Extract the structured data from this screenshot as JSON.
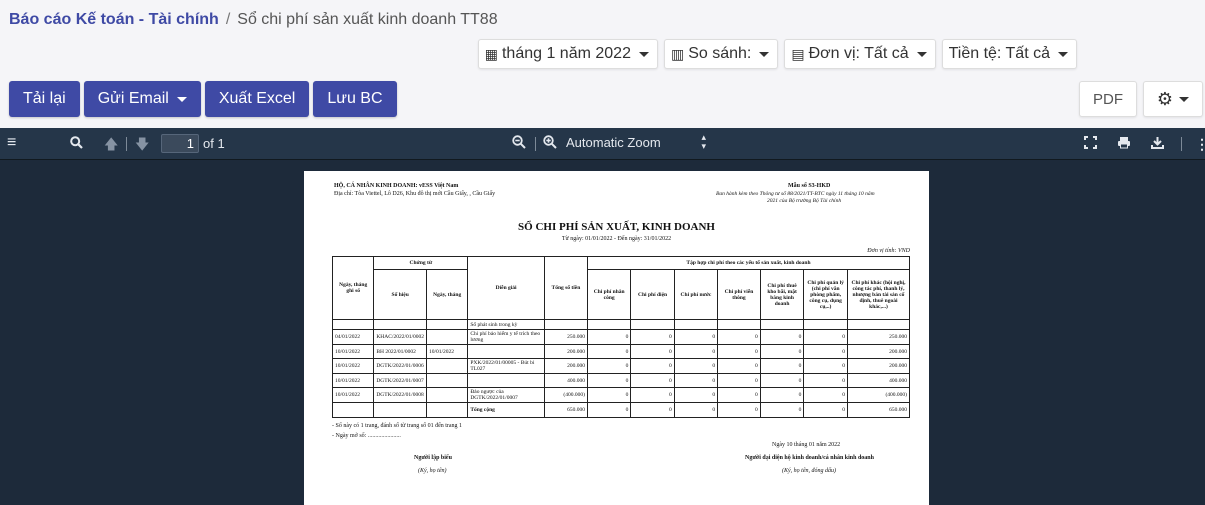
{
  "breadcrumb": {
    "root": "Báo cáo Kế toán - Tài chính",
    "separator": "/",
    "current": "Sổ chi phí sản xuất kinh doanh TT88"
  },
  "filters": {
    "period": "tháng 1 năm 2022",
    "compare": "So sánh:",
    "unit": "Đơn vị: Tất cả",
    "currency": "Tiền tệ: Tất cả"
  },
  "actions": {
    "reload": "Tải lại",
    "email": "Gửi Email",
    "excel": "Xuất Excel",
    "save": "Lưu BC",
    "pdf": "PDF"
  },
  "viewer": {
    "page_num": "1",
    "page_of": "of 1",
    "zoom": "Automatic Zoom"
  },
  "report": {
    "org": "HỘ, CÁ NHÂN KINH DOANH: vESS Việt Nam",
    "address": "Địa chỉ: Tòa Viettel, Lô D26, Khu đô thị mới Cầu Giấy, , Cầu Giấy",
    "form_no": "Mẫu số S3-HKD",
    "legal1": "Ban hành kèm theo Thông tư số 88/2021/TT-BTC ngày 11 tháng 10 năm",
    "legal2": "2021 của Bộ trưởng Bộ Tài chính",
    "title": "SỔ CHI PHÍ SẢN XUẤT, KINH DOANH",
    "date_range": "Từ ngày: 01/01/2022 - Đến ngày: 31/01/2022",
    "currency_unit": "Đơn vị tính: VND",
    "headers": {
      "date": "Ngày, tháng ghi sổ",
      "voucher": "Chứng từ",
      "voucher_no": "Số hiệu",
      "voucher_date": "Ngày, tháng",
      "desc": "Diễn giải",
      "total": "Tổng số tiền",
      "group": "Tập hợp chi phí theo các yếu tố sản xuất, kinh doanh",
      "cols": [
        "Chi phí nhân công",
        "Chi phí điện",
        "Chi phí nước",
        "Chi phí viễn thông",
        "Chi phí thuê kho bãi, mặt bằng kinh doanh",
        "Chi phí quản lý (chi phí văn phòng phẩm, công cụ, dụng cụ,..)",
        "Chi phí khác (hội nghị, công tác phí, thanh lý, nhượng bán tài sản cố định, thuê ngoài khác,...)"
      ]
    },
    "section": "Số phát sinh trong kỳ",
    "rows": [
      {
        "date": "04/01/2022",
        "no": "KHAC/2022/01/0002",
        "vdate": "",
        "desc": "Chi phí bảo hiểm y tế trích theo lương",
        "total": "250.000",
        "c": [
          "0",
          "0",
          "0",
          "0",
          "0",
          "0",
          "250.000"
        ]
      },
      {
        "date": "10/01/2022",
        "no": "BH 2022/01/0002",
        "vdate": "10/01/2022",
        "desc": "",
        "total": "200.000",
        "c": [
          "0",
          "0",
          "0",
          "0",
          "0",
          "0",
          "200.000"
        ]
      },
      {
        "date": "10/01/2022",
        "no": "DGTK/2022/01/0006",
        "vdate": "",
        "desc": "PXK/2022/01/00005 - Bút bi TL027",
        "total": "200.000",
        "c": [
          "0",
          "0",
          "0",
          "0",
          "0",
          "0",
          "200.000"
        ]
      },
      {
        "date": "10/01/2022",
        "no": "DGTK/2022/01/0007",
        "vdate": "",
        "desc": "",
        "total": "400.000",
        "c": [
          "0",
          "0",
          "0",
          "0",
          "0",
          "0",
          "400.000"
        ]
      },
      {
        "date": "10/01/2022",
        "no": "DGTK/2022/01/0008",
        "vdate": "",
        "desc": "Đảo ngược của DGTK/2022/01/0007",
        "total": "(400.000)",
        "c": [
          "0",
          "0",
          "0",
          "0",
          "0",
          "0",
          "(400.000)"
        ]
      }
    ],
    "total_row": {
      "label": "Tổng cộng",
      "total": "650.000",
      "c": [
        "0",
        "0",
        "0",
        "0",
        "0",
        "0",
        "650.000"
      ]
    },
    "note1": "- Sổ này có 1 trang, đánh số từ trang số 01 đến trang 1",
    "note2": "- Ngày mở sổ: ......................",
    "sign_date": "Ngày 10 tháng 01 năm 2022",
    "preparer": "Người lập biểu",
    "preparer_hint": "(Ký, họ tên)",
    "rep": "Người đại diện hộ kinh doanh/cá nhân kinh doanh",
    "rep_hint": "(Ký, họ tên, đóng dấu)"
  }
}
